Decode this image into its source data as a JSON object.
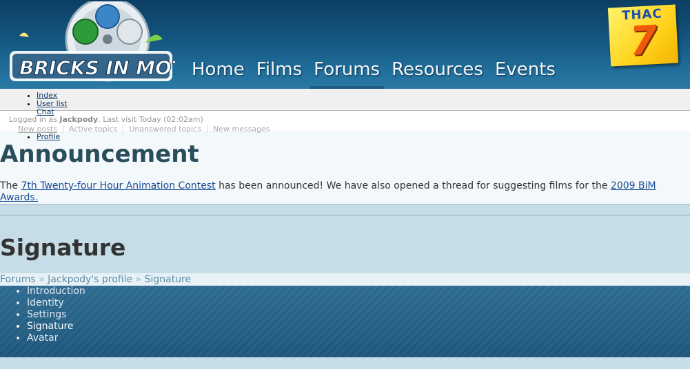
{
  "header": {
    "logo_text": "BRICKS IN MOTION",
    "nav": [
      "Home",
      "Films",
      "Forums",
      "Resources",
      "Events"
    ],
    "active_nav": "Forums",
    "badge_top": "THAC",
    "badge_number": "7"
  },
  "menu": {
    "items": [
      "Index",
      "User list"
    ],
    "hidden_item": "Chat",
    "tail_item": "Profile"
  },
  "status": {
    "prefix": "Logged in as ",
    "username": "Jackpody",
    "suffix": ". Last visit Today (02:02am)",
    "links": [
      "New posts",
      "Active topics",
      "Unanswered topics",
      "New messages"
    ]
  },
  "announcement": {
    "title": "Announcement",
    "text_1": "The ",
    "link_1": "7th Twenty-four Hour Animation Contest",
    "text_2": " has been announced! We have also opened a thread for suggesting films for the ",
    "link_2": "2009 BiM Awards."
  },
  "signature": {
    "title": "Signature",
    "breadcrumb": [
      "Forums",
      "Jackpody's profile",
      "Signature"
    ],
    "breadcrumb_sep": "»",
    "subnav": [
      "Introduction",
      "Identity",
      "Settings",
      "Signature",
      "Avatar"
    ],
    "selected": "Signature"
  },
  "colors": {
    "header_dark": "#0c3e62",
    "header_light": "#2a7aa4",
    "link": "#1a4b94",
    "badge": "#ffd21c",
    "badge_number": "#ee5a0c"
  }
}
